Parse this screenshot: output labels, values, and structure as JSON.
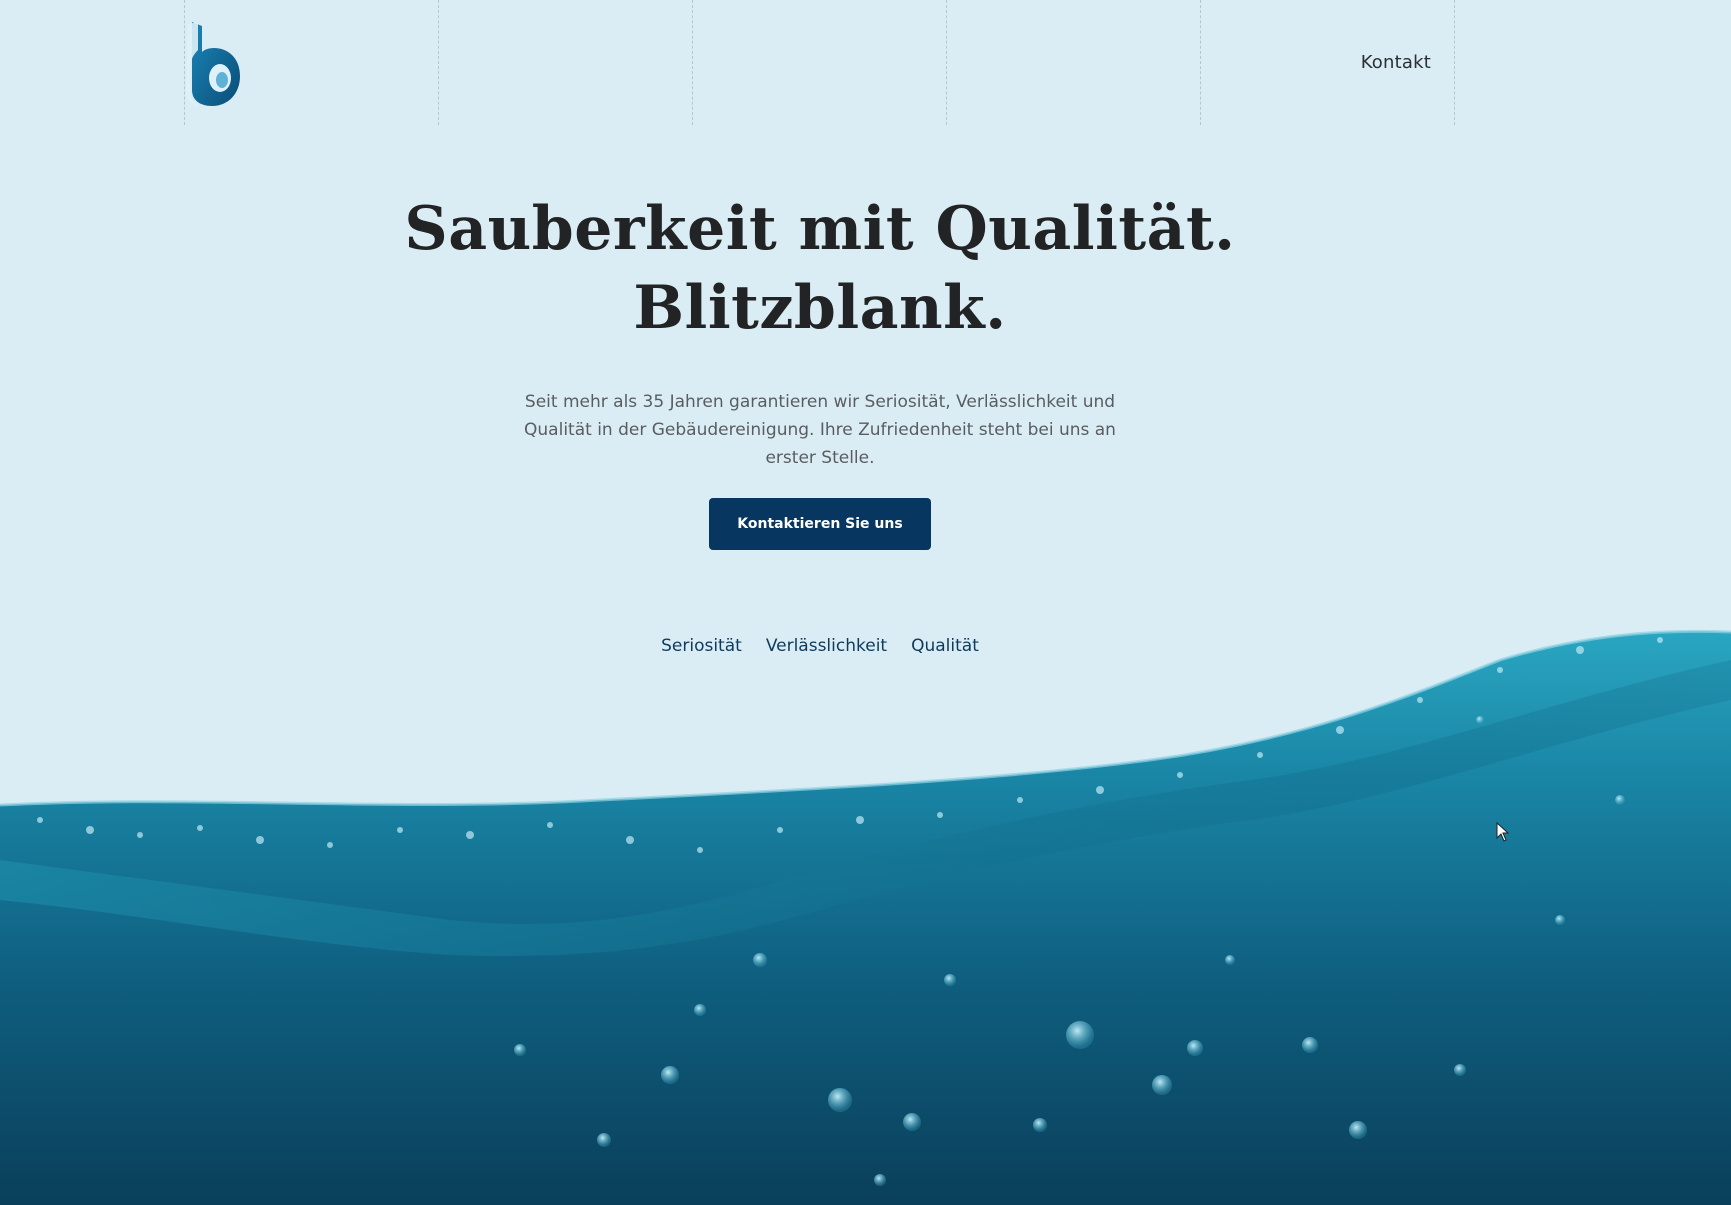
{
  "header": {
    "logo_letter": "b",
    "nav": {
      "contact_label": "Kontakt"
    }
  },
  "hero": {
    "title_line1": "Sauberkeit mit Qualität.",
    "title_line2": "Blitzblank.",
    "description": "Seit mehr als 35 Jahren garantieren wir Seriosität, Verlässlichkeit und Qualität in der Gebäudereinigung. Ihre Zufriedenheit steht bei uns an erster Stelle.",
    "cta_label": "Kontaktieren Sie uns"
  },
  "values": [
    {
      "label": "Seriosität"
    },
    {
      "label": "Verlässlichkeit"
    },
    {
      "label": "Qualität"
    }
  ],
  "colors": {
    "background": "#dbedf4",
    "primary": "#073760",
    "text": "#222325",
    "water_dark": "#0b4a68",
    "water_light": "#1a8fae"
  }
}
